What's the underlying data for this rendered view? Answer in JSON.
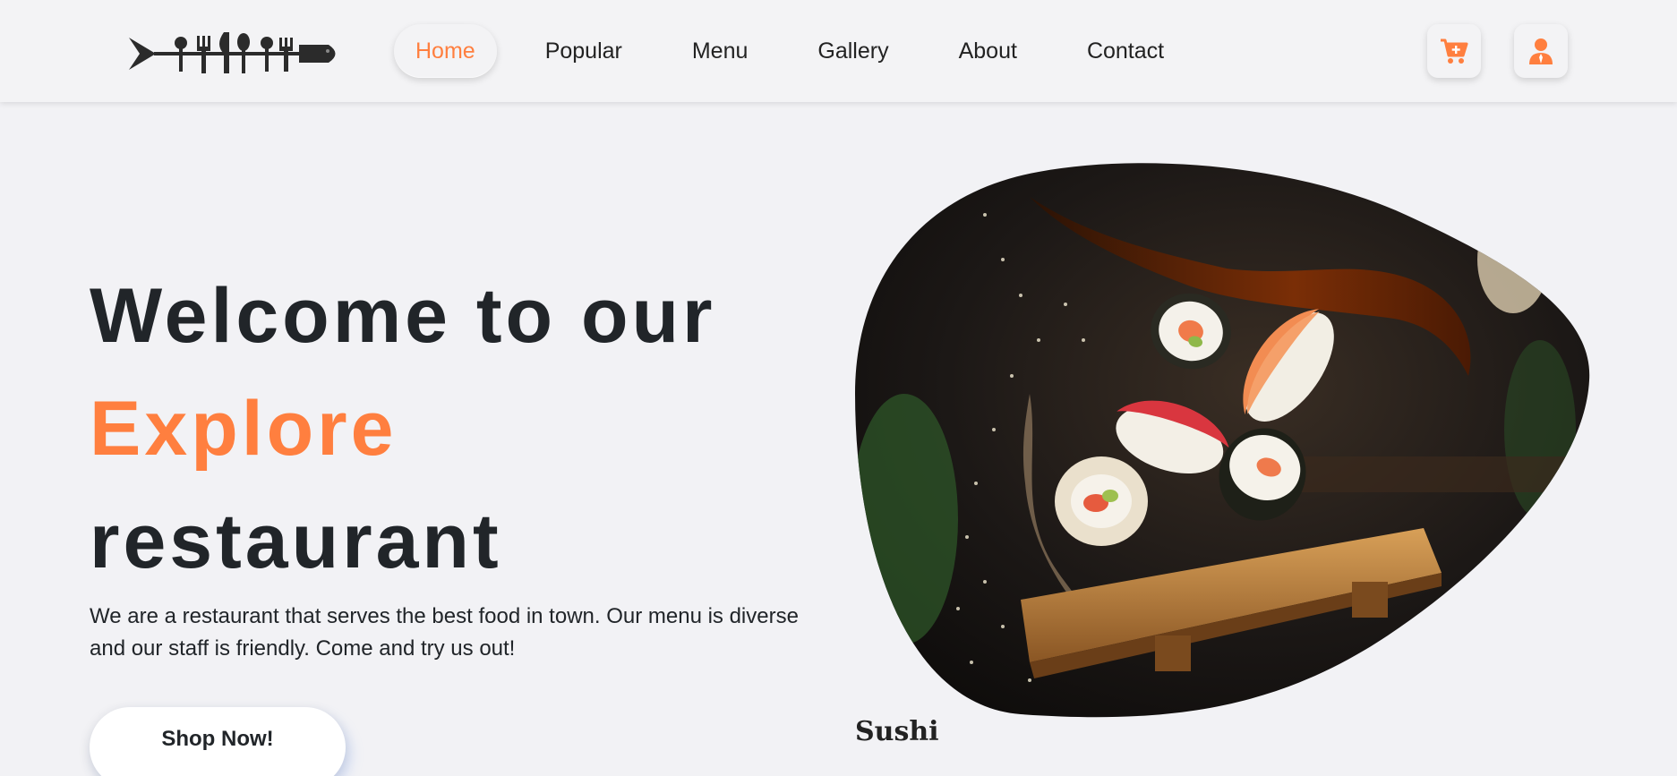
{
  "header": {
    "logo_icon": "cutlery-fish-logo-icon",
    "nav": [
      {
        "label": "Home",
        "active": true
      },
      {
        "label": "Popular",
        "active": false
      },
      {
        "label": "Menu",
        "active": false
      },
      {
        "label": "Gallery",
        "active": false
      },
      {
        "label": "About",
        "active": false
      },
      {
        "label": "Contact",
        "active": false
      }
    ],
    "cart_icon": "cart-plus-icon",
    "user_icon": "user-icon"
  },
  "hero": {
    "title_line1": "Welcome to our",
    "title_line2": "Explore",
    "title_line3": "restaurant",
    "description": "We are a restaurant that serves the best food in town. Our menu is diverse and our staff is friendly. Come and try us out!",
    "cta_label": "Shop Now!"
  },
  "feature": {
    "title": "Sushi"
  },
  "colors": {
    "accent": "#ff7f3f",
    "text": "#212529",
    "background": "#f2f2f5"
  }
}
